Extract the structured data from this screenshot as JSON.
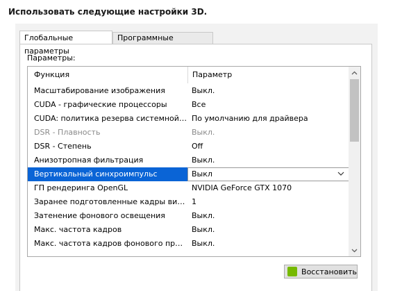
{
  "heading": "Использовать следующие настройки 3D.",
  "tabs": [
    {
      "label": "Глобальные параметры",
      "active": true
    },
    {
      "label": "Программные настройки",
      "active": false
    }
  ],
  "params_label": "Параметры:",
  "grid": {
    "col_feature": "Функция",
    "col_setting": "Параметр",
    "rows": [
      {
        "feature": "Масштабирование изображения",
        "setting": "Выкл."
      },
      {
        "feature": "CUDA - графические процессоры",
        "setting": "Все"
      },
      {
        "feature": "CUDA: политика резерва системной пам...",
        "setting": "По умолчанию для драйвера"
      },
      {
        "feature": "DSR - Плавность",
        "setting": "Выкл."
      },
      {
        "feature": "DSR - Степень",
        "setting": "Off"
      },
      {
        "feature": "Анизотропная фильтрация",
        "setting": "Выкл."
      },
      {
        "feature": "Вертикальный синхроимпульс",
        "setting": "Выкл"
      },
      {
        "feature": "ГП рендеринга OpenGL",
        "setting": "NVIDIA GeForce GTX 1070"
      },
      {
        "feature": "Заранее подготовленные кадры вирту...",
        "setting": "1"
      },
      {
        "feature": "Затенение фонового освещения",
        "setting": "Выкл."
      },
      {
        "feature": "Макс. частота кадров",
        "setting": "Выкл."
      },
      {
        "feature": "Макс. частота кадров фонового прило...",
        "setting": "Выкл."
      }
    ]
  },
  "restore_button": "Восстановить",
  "colors": {
    "selection": "#0a64d6",
    "nvidia_green": "#76b900"
  }
}
